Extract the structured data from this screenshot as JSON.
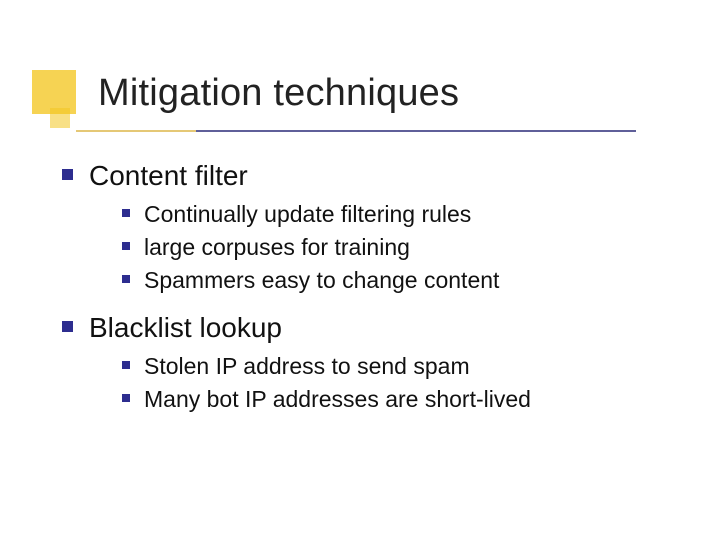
{
  "title": "Mitigation techniques",
  "sections": [
    {
      "heading": "Content filter",
      "items": [
        "Continually update filtering rules",
        "large corpuses for training",
        "Spammers easy to change content"
      ]
    },
    {
      "heading": "Blacklist lookup",
      "items": [
        "Stolen IP address to send spam",
        "Many bot IP addresses are short-lived"
      ]
    }
  ],
  "colors": {
    "bullet": "#2d2d8f",
    "accent": "#f3c623"
  }
}
